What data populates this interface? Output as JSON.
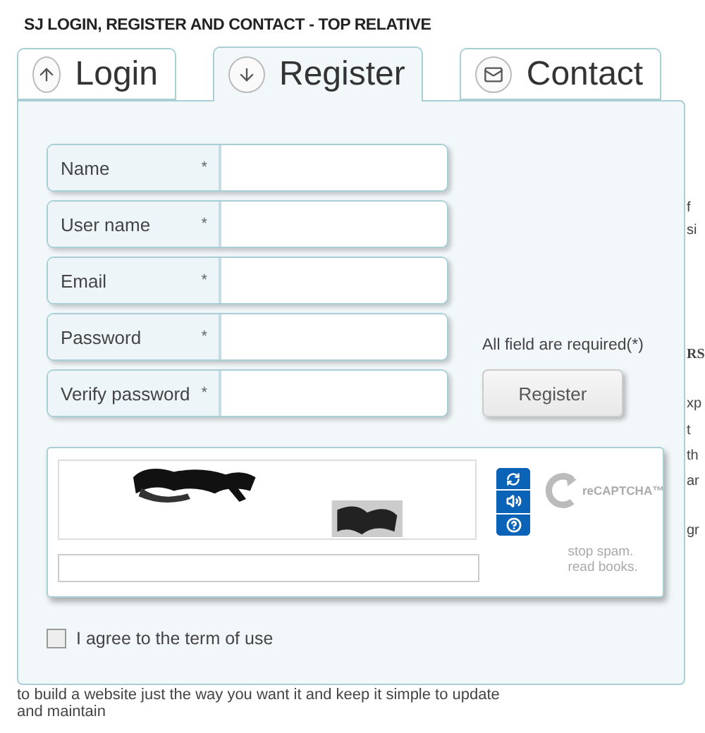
{
  "heading": "SJ LOGIN, REGISTER AND CONTACT - TOP RELATIVE",
  "tabs": [
    {
      "label": "Login",
      "kind": "up",
      "selected": false
    },
    {
      "label": "Register",
      "kind": "down",
      "selected": true
    },
    {
      "label": "Contact",
      "kind": "mail",
      "selected": false
    }
  ],
  "fields": [
    {
      "label": "Name",
      "mark": "*"
    },
    {
      "label": "User name",
      "mark": "*"
    },
    {
      "label": "Email",
      "mark": "*"
    },
    {
      "label": "Password",
      "mark": "*"
    },
    {
      "label": "Verify password",
      "mark": "*"
    }
  ],
  "required_note": "All field are required(*)",
  "register_button": "Register",
  "captcha": {
    "logo": "reCAPTCHA™",
    "tagline": [
      "stop spam.",
      "read books."
    ]
  },
  "agree": {
    "label": "I agree to the term of use",
    "checked": false
  },
  "background_text": {
    "fragments": [
      "f",
      "si",
      "RS",
      "xp",
      "t",
      "th",
      "ar",
      "gr"
    ],
    "lines": [
      "to build a website just the way you want it and keep it simple to update",
      "and maintain"
    ]
  }
}
